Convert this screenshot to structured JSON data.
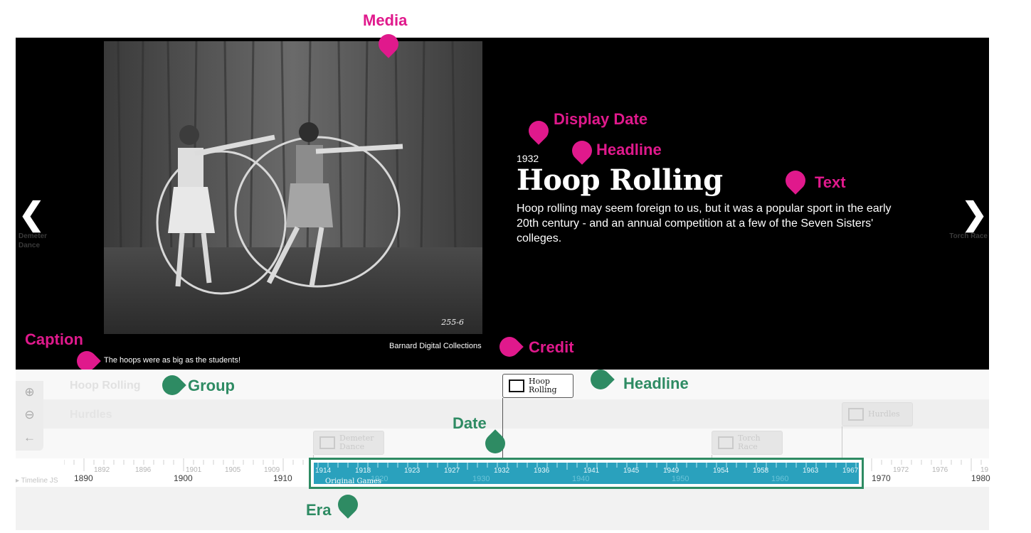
{
  "annotations": {
    "media": "Media",
    "display_date": "Display Date",
    "headline_top": "Headline",
    "text": "Text",
    "caption": "Caption",
    "credit": "Credit",
    "group": "Group",
    "headline_bottom": "Headline",
    "date": "Date",
    "era": "Era"
  },
  "slide": {
    "display_date": "1932",
    "headline": "Hoop Rolling",
    "text": "Hoop rolling may seem foreign to us, but it was a popular sport in the early 20th century - and an annual competition at a few of the Seven Sisters' colleges.",
    "caption": "The hoops were as big as the students!",
    "credit": "Barnard Digital Collections",
    "photo_number": "255-6",
    "prev_label": "Demeter Dance",
    "next_label": "Torch Race"
  },
  "timenav": {
    "groups": [
      "Hoop Rolling",
      "Hurdles"
    ],
    "markers": {
      "hoop_rolling": "Hoop Rolling",
      "hurdles": "Hurdles",
      "demeter": "Demeter Dance",
      "torch": "Torch Race"
    },
    "era_label": "Original Games",
    "branding": "Timeline JS",
    "minor_ticks_left": [
      "1892",
      "1896",
      "1901",
      "1905",
      "1909"
    ],
    "major_ticks_left": [
      "1890",
      "1900",
      "1910"
    ],
    "minor_ticks_era": [
      "1914",
      "1918",
      "1923",
      "1927",
      "1932",
      "1936",
      "1941",
      "1945",
      "1949",
      "1954",
      "1958",
      "1963",
      "1967"
    ],
    "major_ticks_era": [
      "1920",
      "1930",
      "1940",
      "1950",
      "1960"
    ],
    "minor_ticks_right": [
      "1972",
      "1976",
      "19"
    ],
    "major_ticks_right": [
      "1970",
      "1980"
    ]
  },
  "colors": {
    "annotation_pink": "#e0198c",
    "annotation_green": "#2e8b63",
    "era_blue": "#2aa1bd"
  }
}
